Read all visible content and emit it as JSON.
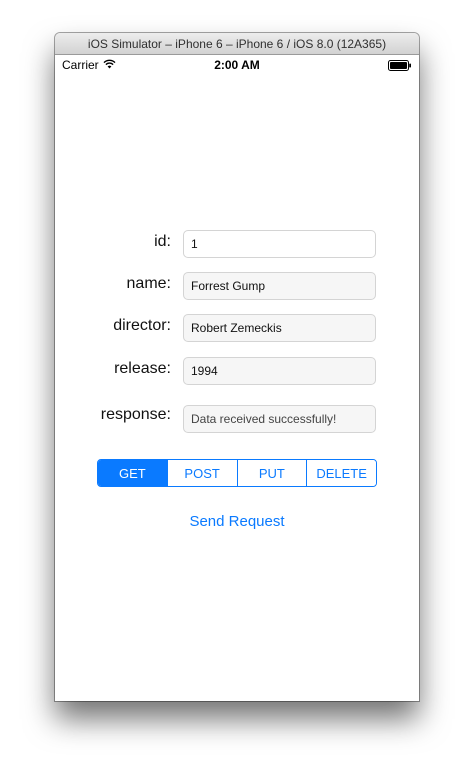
{
  "window": {
    "title": "iOS Simulator – iPhone 6 – iPhone 6 / iOS 8.0 (12A365)"
  },
  "status_bar": {
    "carrier": "Carrier",
    "time": "2:00 AM",
    "icons": [
      "wifi-icon",
      "battery-icon"
    ]
  },
  "form": {
    "id_label": "id:",
    "id_value": "1",
    "name_label": "name:",
    "name_value": "Forrest Gump",
    "director_label": "director:",
    "director_value": "Robert Zemeckis",
    "release_label": "release:",
    "release_value": "1994",
    "response_label": "response:",
    "response_value": "Data received successfully!"
  },
  "methods": {
    "options": [
      "GET",
      "POST",
      "PUT",
      "DELETE"
    ],
    "selected": "GET"
  },
  "send_label": "Send Request",
  "colors": {
    "accent": "#0a7aff"
  }
}
